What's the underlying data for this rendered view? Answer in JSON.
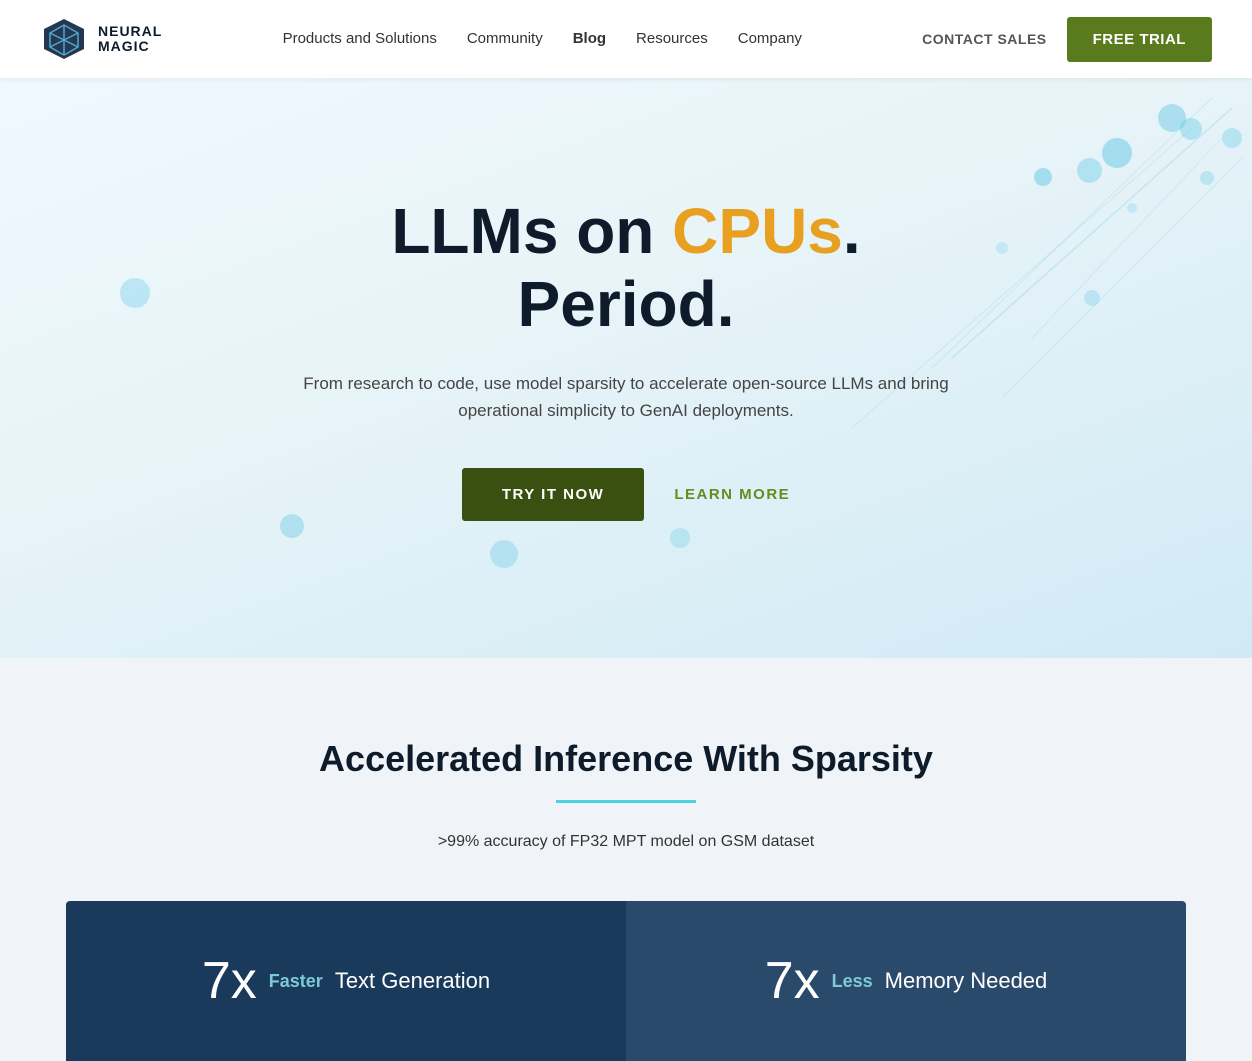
{
  "brand": {
    "name_line1": "NEURAL",
    "name_line2": "MAGIC"
  },
  "nav": {
    "links": [
      {
        "label": "Products and Solutions",
        "active": false
      },
      {
        "label": "Community",
        "active": false
      },
      {
        "label": "Blog",
        "active": true
      },
      {
        "label": "Resources",
        "active": false
      },
      {
        "label": "Company",
        "active": false
      }
    ],
    "contact_sales": "CONTACT SALES",
    "free_trial": "FREE TRIAL"
  },
  "hero": {
    "headline_part1": "LLMs on ",
    "headline_highlight": "CPUs",
    "headline_part2": ".",
    "headline_line2": "Period.",
    "subtext": "From research to code, use model sparsity to accelerate open-source LLMs and bring operational simplicity to GenAI deployments.",
    "cta_primary": "TRY IT NOW",
    "cta_secondary": "LEARN MORE"
  },
  "stats": {
    "heading": "Accelerated Inference With Sparsity",
    "description": ">99% accuracy of FP32 MPT model on GSM dataset",
    "cards": [
      {
        "number": "7x",
        "highlight": "Faster",
        "rest": "Text Generation"
      },
      {
        "number": "7x",
        "highlight": "Less",
        "rest": "Memory Needed"
      }
    ]
  }
}
